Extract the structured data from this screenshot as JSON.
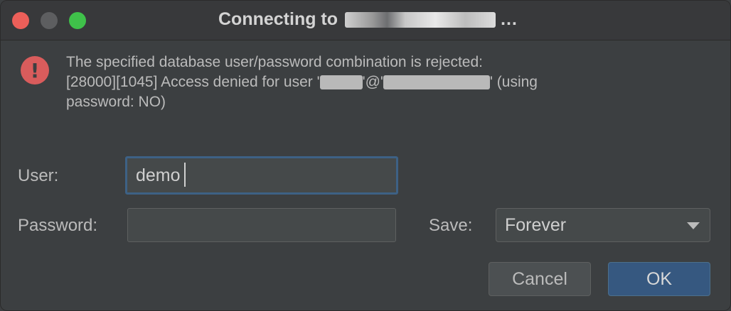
{
  "window": {
    "title_prefix": "Connecting to",
    "title_suffix": "…"
  },
  "error": {
    "line1": "The specified database user/password combination is rejected:",
    "line2_prefix": "[28000][1045] Access denied for user '",
    "line2_mid": "'@'",
    "line2_suffix": "' (using",
    "line3": "password: NO)"
  },
  "form": {
    "user_label": "User:",
    "user_value": "demo",
    "password_label": "Password:",
    "password_value": "",
    "save_label": "Save:",
    "save_selected": "Forever"
  },
  "buttons": {
    "cancel": "Cancel",
    "ok": "OK"
  },
  "colors": {
    "background": "#3c3f41",
    "error_icon": "#d95c5c",
    "focus_border": "#3d6185",
    "ok_button": "#365880"
  }
}
